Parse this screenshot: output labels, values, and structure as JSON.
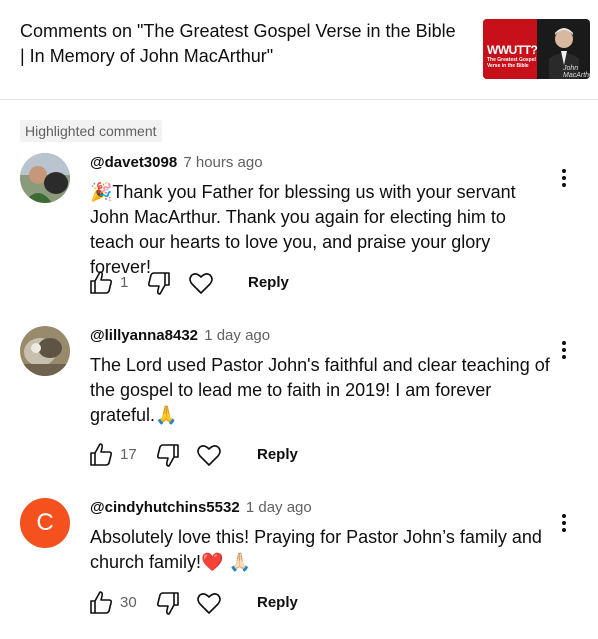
{
  "header": {
    "title": "Comments on \"The Greatest Gospel Verse in the Bible | In Memory of John MacArthur\"",
    "thumbnail_text_big": "WWUTT?",
    "thumbnail_text_small": "The Greatest Gospel Verse in the Bible",
    "thumbnail_signature": "John MacArthur"
  },
  "highlighted_label": "Highlighted comment",
  "comments": [
    {
      "author": "@davet3098",
      "time": "7 hours ago",
      "text": "🎉Thank you Father for blessing us with your servant John MacArthur. Thank you again for electing him to teach our hearts to love you, and praise your glory forever!",
      "likes": "1",
      "reply_label": "Reply"
    },
    {
      "author": "@lillyanna8432",
      "time": "1 day ago",
      "text": "The Lord used Pastor John's faithful and clear teaching of the gospel to lead me to faith in 2019! I am forever grateful.🙏",
      "likes": "17",
      "reply_label": "Reply"
    },
    {
      "author": "@cindyhutchins5532",
      "time": "1 day ago",
      "avatar_letter": "C",
      "text": "Absolutely love this! Praying for Pastor John’s family and church family!❤️ 🙏🏻",
      "likes": "30",
      "reply_label": "Reply"
    }
  ],
  "colors": {
    "avatar_c": "#f4511e",
    "secondary_text": "#606060",
    "badge_bg": "#f2f2f2"
  }
}
